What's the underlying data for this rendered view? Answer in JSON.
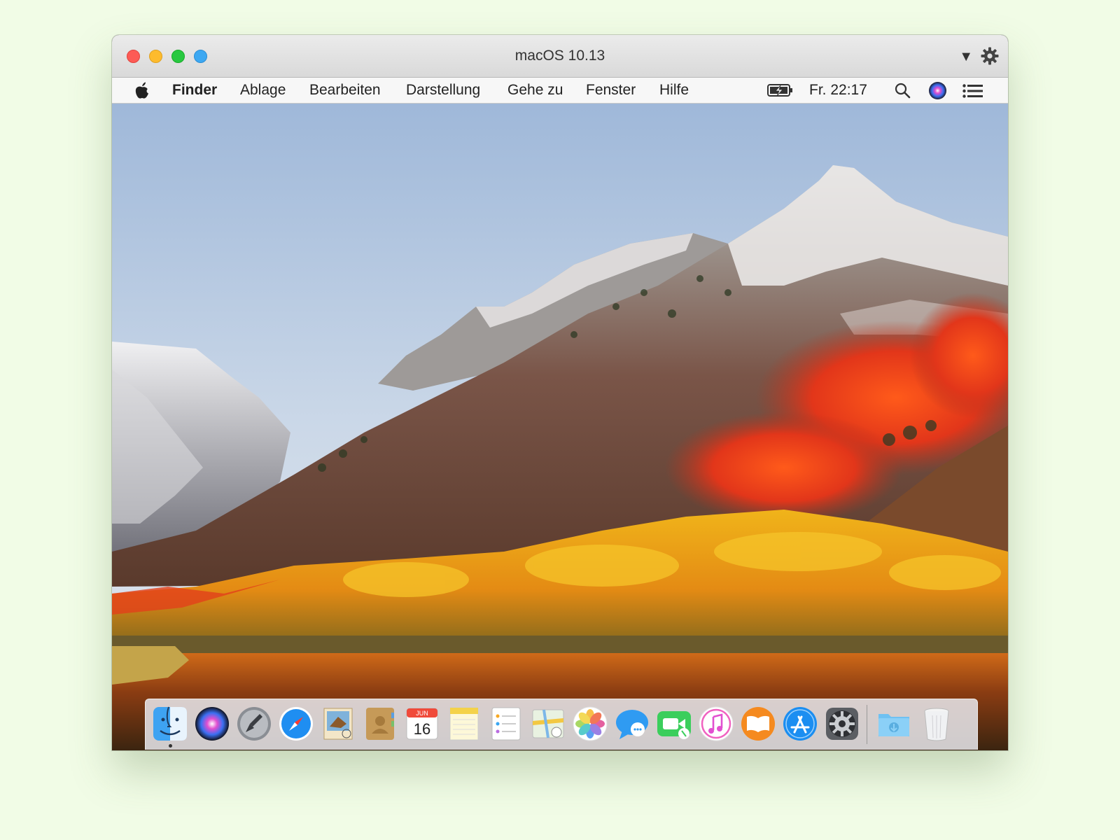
{
  "window": {
    "title": "macOS 10.13",
    "controls": [
      "close",
      "minimize",
      "maximize",
      "extra"
    ],
    "dropdown_glyph": "▼",
    "settings_icon": "gear-icon"
  },
  "menubar": {
    "apple_icon": "apple-logo-icon",
    "app_name": "Finder",
    "items": [
      "Ablage",
      "Bearbeiten",
      "Darstellung",
      "Gehe zu",
      "Fenster",
      "Hilfe"
    ],
    "clock": "Fr. 22:17",
    "status_icons": [
      "battery-charging-icon",
      "spotlight-search-icon",
      "siri-icon",
      "notification-center-icon"
    ]
  },
  "desktop": {
    "wallpaper": "autumn mountain landscape with lake"
  },
  "dock": {
    "apps": [
      "Finder",
      "Siri",
      "Launchpad",
      "Safari",
      "Mail",
      "Kontakte",
      "Kalender",
      "Notizen",
      "Erinnerungen",
      "Karten",
      "Fotos",
      "Nachrichten",
      "FaceTime",
      "iTunes",
      "iBooks",
      "App Store",
      "Systemeinstellungen",
      "Downloads",
      "Papierkorb"
    ],
    "calendar": {
      "month": "JUN",
      "day": "16"
    },
    "running": [
      "Finder"
    ]
  },
  "colors": {
    "page_background": "#f1fce6",
    "close": "#fd5b55",
    "minimize": "#fdbb2d",
    "maximize": "#28c840",
    "extra": "#3da8f2"
  }
}
